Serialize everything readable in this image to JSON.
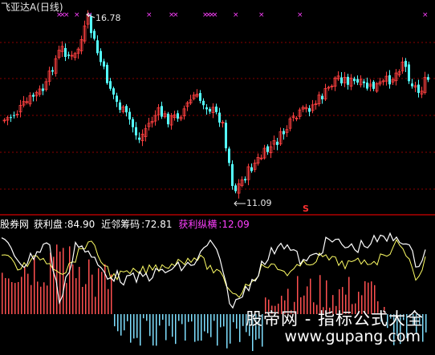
{
  "header": {
    "stock_name": "飞亚达A",
    "period": "(日线)"
  },
  "annotations": {
    "high_label": "16.78",
    "low_label": "11.09",
    "signal": "S"
  },
  "indicator_bar": {
    "source": "股券网",
    "profit_label": "获利盘",
    "profit_value": "84.90",
    "chip_label": "近邻筹码",
    "chip_value": "72.81",
    "trend_label": "获利纵横",
    "trend_value": "12.09"
  },
  "watermark": {
    "text": "股帝网 - 指标公式大全",
    "url": "www.gupang.com"
  },
  "colors": {
    "background": "#000000",
    "up_candle": "#ff4040",
    "down_candle": "#54ffff",
    "grid": "#8b0000",
    "profit_line": "#ffffff",
    "chip_line": "#ffff66",
    "marker": "#ff40ff"
  }
}
